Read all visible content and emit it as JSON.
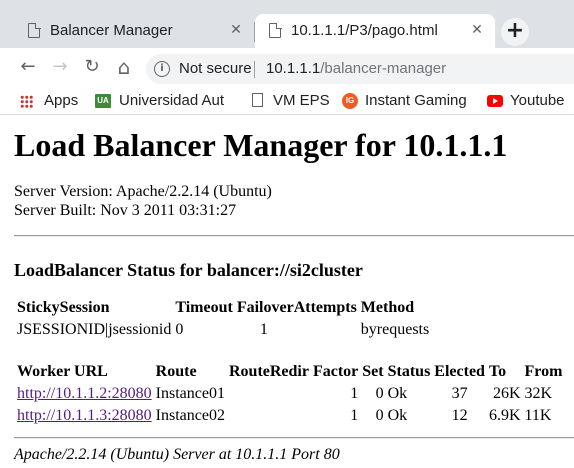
{
  "browser": {
    "tabs": [
      {
        "title": "Balancer Manager",
        "close": "✕",
        "active": false
      },
      {
        "title": "10.1.1.1/P3/pago.html",
        "close": "✕",
        "active": true
      }
    ],
    "new_tab": "+",
    "nav": {
      "back": "←",
      "forward": "→",
      "reload": "↻",
      "home": "⌂"
    },
    "security_label": "Not secure",
    "url_host": "10.1.1.1",
    "url_path": "/balancer-manager",
    "bookmarks": [
      {
        "label": "Apps",
        "icon": "apps-grid-icon"
      },
      {
        "label": "Universidad Aut",
        "icon": "university-logo-icon"
      },
      {
        "label": "VM EPS",
        "icon": "document-icon"
      },
      {
        "label": "Instant Gaming",
        "icon": "instant-gaming-icon"
      },
      {
        "label": "Youtube",
        "icon": "youtube-icon"
      }
    ]
  },
  "page": {
    "title": "Load Balancer Manager for 10.1.1.1",
    "server_version": "Server Version: Apache/2.2.14 (Ubuntu)",
    "server_built": "Server Built: Nov 3 2011 03:31:27",
    "balancer_heading": "LoadBalancer Status for balancer://si2cluster",
    "lb_headers": [
      "StickySession",
      "Timeout",
      "FailoverAttempts",
      "Method"
    ],
    "lb_row": [
      "JSESSIONID|jsessionid",
      "0",
      "1",
      "byrequests"
    ],
    "worker_headers": [
      "Worker URL",
      "Route",
      "RouteRedir",
      "Factor",
      "Set",
      "Status",
      "Elected",
      "To",
      "From"
    ],
    "workers": [
      [
        "http://10.1.1.2:28080",
        "Instance01",
        "",
        "1",
        "0",
        "Ok",
        "37",
        "26K",
        "32K"
      ],
      [
        "http://10.1.1.3:28080",
        "Instance02",
        "",
        "1",
        "0",
        "Ok",
        "12",
        "6.9K",
        "11K"
      ]
    ],
    "address": "Apache/2.2.14 (Ubuntu) Server at 10.1.1.1 Port 80"
  }
}
